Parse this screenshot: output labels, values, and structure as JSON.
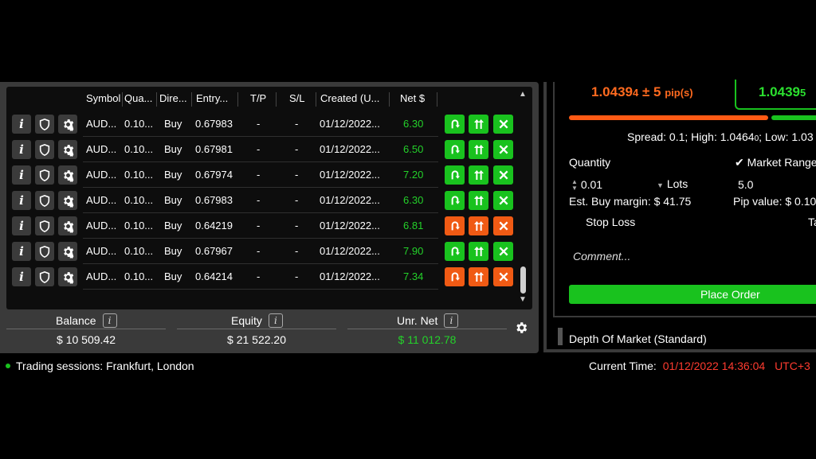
{
  "columns": {
    "symbol": "Symbol",
    "quantity": "Qua...",
    "direction": "Dire...",
    "entry": "Entry...",
    "tp": "T/P",
    "sl": "S/L",
    "created": "Created (U...",
    "net": "Net $"
  },
  "positions": [
    {
      "symbol": "AUD...",
      "qty": "0.10...",
      "dir": "Buy",
      "entry": "0.67983",
      "tp": "-",
      "sl": "-",
      "created": "01/12/2022...",
      "net": "6.30",
      "action_color": "green"
    },
    {
      "symbol": "AUD...",
      "qty": "0.10...",
      "dir": "Buy",
      "entry": "0.67981",
      "tp": "-",
      "sl": "-",
      "created": "01/12/2022...",
      "net": "6.50",
      "action_color": "green"
    },
    {
      "symbol": "AUD...",
      "qty": "0.10...",
      "dir": "Buy",
      "entry": "0.67974",
      "tp": "-",
      "sl": "-",
      "created": "01/12/2022...",
      "net": "7.20",
      "action_color": "green"
    },
    {
      "symbol": "AUD...",
      "qty": "0.10...",
      "dir": "Buy",
      "entry": "0.67983",
      "tp": "-",
      "sl": "-",
      "created": "01/12/2022...",
      "net": "6.30",
      "action_color": "green"
    },
    {
      "symbol": "AUD...",
      "qty": "0.10...",
      "dir": "Buy",
      "entry": "0.64219",
      "tp": "-",
      "sl": "-",
      "created": "01/12/2022...",
      "net": "6.81",
      "action_color": "orange"
    },
    {
      "symbol": "AUD...",
      "qty": "0.10...",
      "dir": "Buy",
      "entry": "0.67967",
      "tp": "-",
      "sl": "-",
      "created": "01/12/2022...",
      "net": "7.90",
      "action_color": "green"
    },
    {
      "symbol": "AUD...",
      "qty": "0.10...",
      "dir": "Buy",
      "entry": "0.64214",
      "tp": "-",
      "sl": "-",
      "created": "01/12/2022...",
      "net": "7.34",
      "action_color": "orange"
    }
  ],
  "summary": {
    "balance_label": "Balance",
    "balance": "$ 10 509.42",
    "equity_label": "Equity",
    "equity": "$ 21 522.20",
    "unr_label": "Unr. Net",
    "unr": "$ 11 012.78",
    "info": "i"
  },
  "order": {
    "sell_main": "1.0439",
    "sell_small": "4",
    "spread_pm": "± 5",
    "pips": "pip(s)",
    "buy_main": "1.0439",
    "buy_small": "5",
    "spread_line": "Spread: 0.1; High: 1.0464",
    "high_small": "0",
    "low_text": "; Low: 1.03",
    "quantity_label": "Quantity",
    "market_range_label": "Market Range",
    "quantity_value": "0.01",
    "lots_label": "Lots",
    "market_range_value": "5.0",
    "margin": "Est. Buy margin: $ 41.75",
    "pip_value": "Pip value: $ 0.10",
    "stop_loss": "Stop Loss",
    "take_profit_clip": "Ta",
    "comment_placeholder": "Comment...",
    "place_order": "Place Order",
    "dom_label": "Depth Of Market (Standard)"
  },
  "footer": {
    "sessions": "Trading sessions: Frankfurt, London",
    "time_label": "Current Time:",
    "time_value": "01/12/2022 14:36:04",
    "tz": "UTC+3"
  },
  "colors": {
    "green": "#19c21e",
    "orange": "#f05a14",
    "sell": "#ff6a1f",
    "net_green": "#24d22a",
    "time_red": "#ff3b2f"
  },
  "icons": [
    "info-icon",
    "shield-icon",
    "gear-icon",
    "reverse-icon",
    "double-up-icon",
    "close-icon",
    "checkmark-icon",
    "stepper-icon",
    "dropdown-icon"
  ]
}
